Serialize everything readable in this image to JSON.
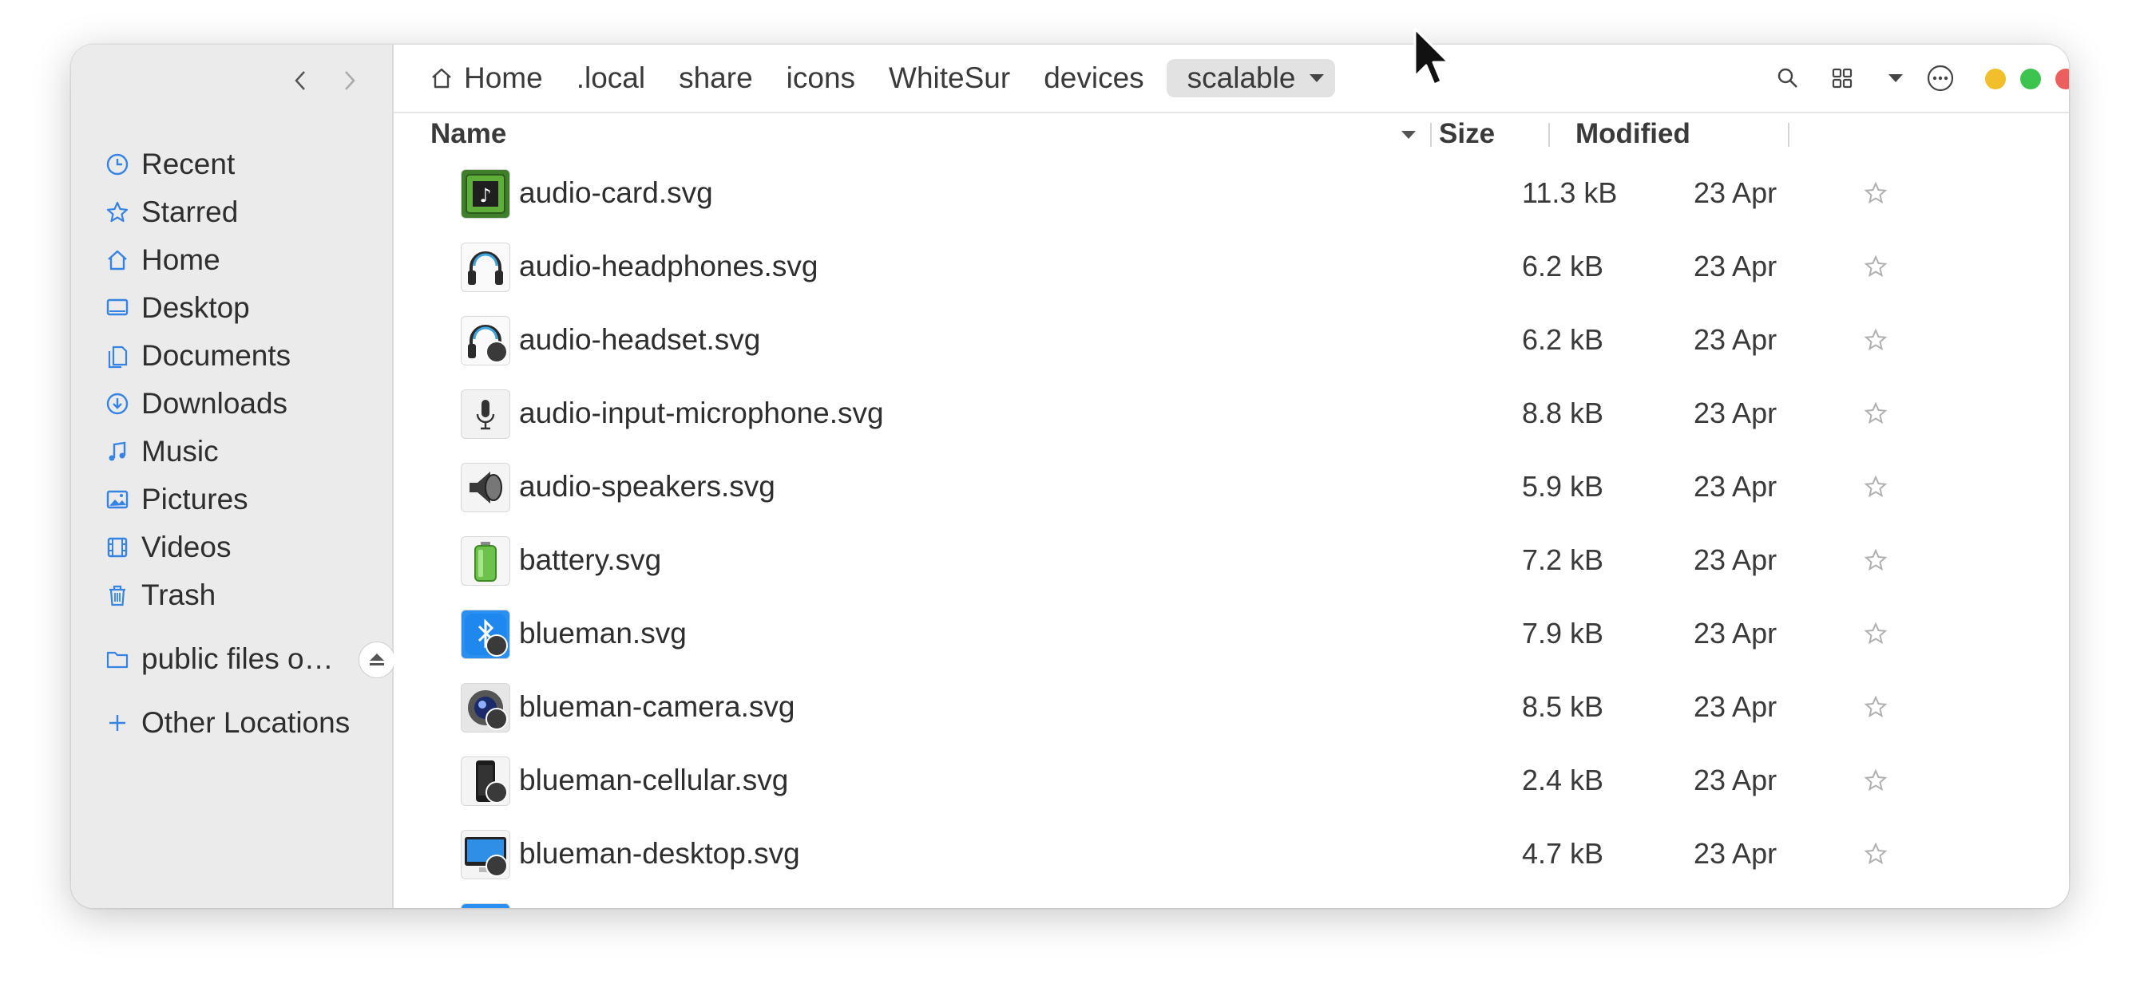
{
  "sidebar": {
    "items": [
      {
        "label": "Recent",
        "icon": "clock-icon"
      },
      {
        "label": "Starred",
        "icon": "star-icon"
      },
      {
        "label": "Home",
        "icon": "home-icon"
      },
      {
        "label": "Desktop",
        "icon": "desktop-icon"
      },
      {
        "label": "Documents",
        "icon": "documents-icon"
      },
      {
        "label": "Downloads",
        "icon": "download-icon"
      },
      {
        "label": "Music",
        "icon": "music-icon"
      },
      {
        "label": "Pictures",
        "icon": "pictures-icon"
      },
      {
        "label": "Videos",
        "icon": "videos-icon"
      },
      {
        "label": "Trash",
        "icon": "trash-icon"
      }
    ],
    "mount": {
      "label": "public files o…",
      "icon": "folder-icon"
    },
    "other_locations": "Other Locations"
  },
  "breadcrumb": [
    "Home",
    ".local",
    "share",
    "icons",
    "WhiteSur",
    "devices",
    "scalable"
  ],
  "columns": {
    "name": "Name",
    "size": "Size",
    "modified": "Modified"
  },
  "files": [
    {
      "name": "audio-card.svg",
      "size": "11.3 kB",
      "modified": "23 Apr",
      "icon": "audio-card-icon",
      "link": false
    },
    {
      "name": "audio-headphones.svg",
      "size": "6.2 kB",
      "modified": "23 Apr",
      "icon": "headphones-icon",
      "link": false
    },
    {
      "name": "audio-headset.svg",
      "size": "6.2 kB",
      "modified": "23 Apr",
      "icon": "headset-icon",
      "link": true
    },
    {
      "name": "audio-input-microphone.svg",
      "size": "8.8 kB",
      "modified": "23 Apr",
      "icon": "microphone-icon",
      "link": false
    },
    {
      "name": "audio-speakers.svg",
      "size": "5.9 kB",
      "modified": "23 Apr",
      "icon": "speaker-icon",
      "link": false
    },
    {
      "name": "battery.svg",
      "size": "7.2 kB",
      "modified": "23 Apr",
      "icon": "battery-icon",
      "link": false
    },
    {
      "name": "blueman.svg",
      "size": "7.9 kB",
      "modified": "23 Apr",
      "icon": "bluetooth-icon",
      "link": true
    },
    {
      "name": "blueman-camera.svg",
      "size": "8.5 kB",
      "modified": "23 Apr",
      "icon": "camera-icon",
      "link": true
    },
    {
      "name": "blueman-cellular.svg",
      "size": "2.4 kB",
      "modified": "23 Apr",
      "icon": "phone-icon",
      "link": true
    },
    {
      "name": "blueman-desktop.svg",
      "size": "4.7 kB",
      "modified": "23 Apr",
      "icon": "monitor-icon",
      "link": true
    }
  ],
  "colors": {
    "sidebar_bg": "#ebebeb",
    "accent": "#3584e4",
    "close": "#ed5f5d",
    "maximize": "#3cc44f",
    "minimize": "#f2be2a"
  }
}
